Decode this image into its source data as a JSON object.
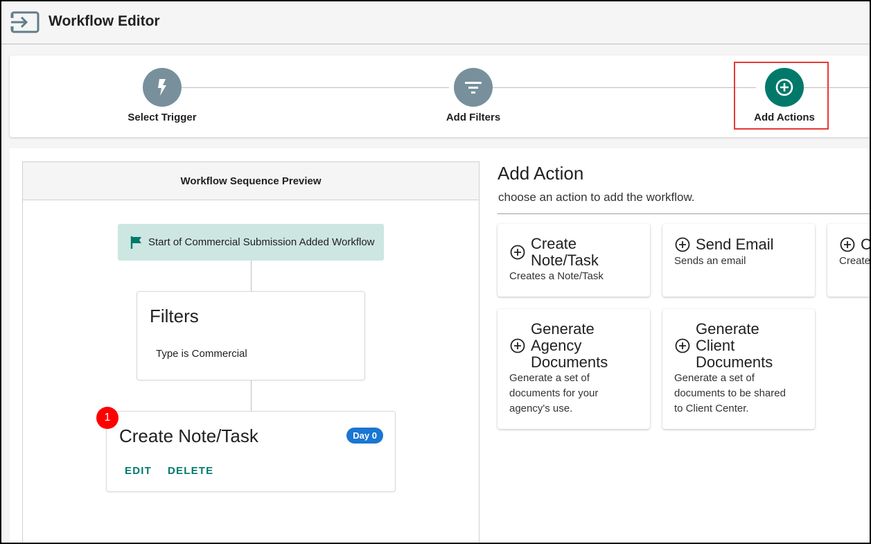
{
  "header": {
    "title": "Workflow Editor"
  },
  "stepper": {
    "steps": [
      {
        "label": "Select Trigger",
        "icon": "lightning-icon",
        "active": false
      },
      {
        "label": "Add Filters",
        "icon": "filter-icon",
        "active": false
      },
      {
        "label": "Add Actions",
        "icon": "add-circle-icon",
        "active": true
      }
    ]
  },
  "preview": {
    "title": "Workflow Sequence Preview",
    "start_label": "Start of Commercial Submission Added Workflow",
    "filters_title": "Filters",
    "filters_text": "Type is Commercial",
    "action": {
      "number": "1",
      "title": "Create Note/Task",
      "day_badge": "Day 0",
      "edit_label": "EDIT",
      "delete_label": "DELETE"
    }
  },
  "add_action": {
    "title": "Add Action",
    "subtitle": "choose an action to add the workflow.",
    "options": [
      {
        "title_lines": [
          "Create",
          "Note/Task"
        ],
        "desc_lines": [
          "Creates a Note/Task"
        ]
      },
      {
        "title_lines": [
          "Send Email"
        ],
        "desc_lines": [
          "Sends an email"
        ]
      },
      {
        "title_lines": [
          "C"
        ],
        "desc_lines": [
          "Create"
        ]
      },
      {
        "title_lines": [
          "Generate",
          "Agency",
          "Documents"
        ],
        "desc_lines": [
          "Generate a set of",
          "documents for your",
          "agency's use."
        ]
      },
      {
        "title_lines": [
          "Generate",
          "Client",
          "Documents"
        ],
        "desc_lines": [
          "Generate a set of",
          "documents to be shared",
          "to Client Center."
        ]
      }
    ]
  },
  "colors": {
    "teal": "#00796b",
    "step_grey": "#78909c",
    "start_chip": "#cde6e1",
    "day_badge": "#1976d2",
    "highlight": "#e53935",
    "number_badge": "#ff0000"
  }
}
